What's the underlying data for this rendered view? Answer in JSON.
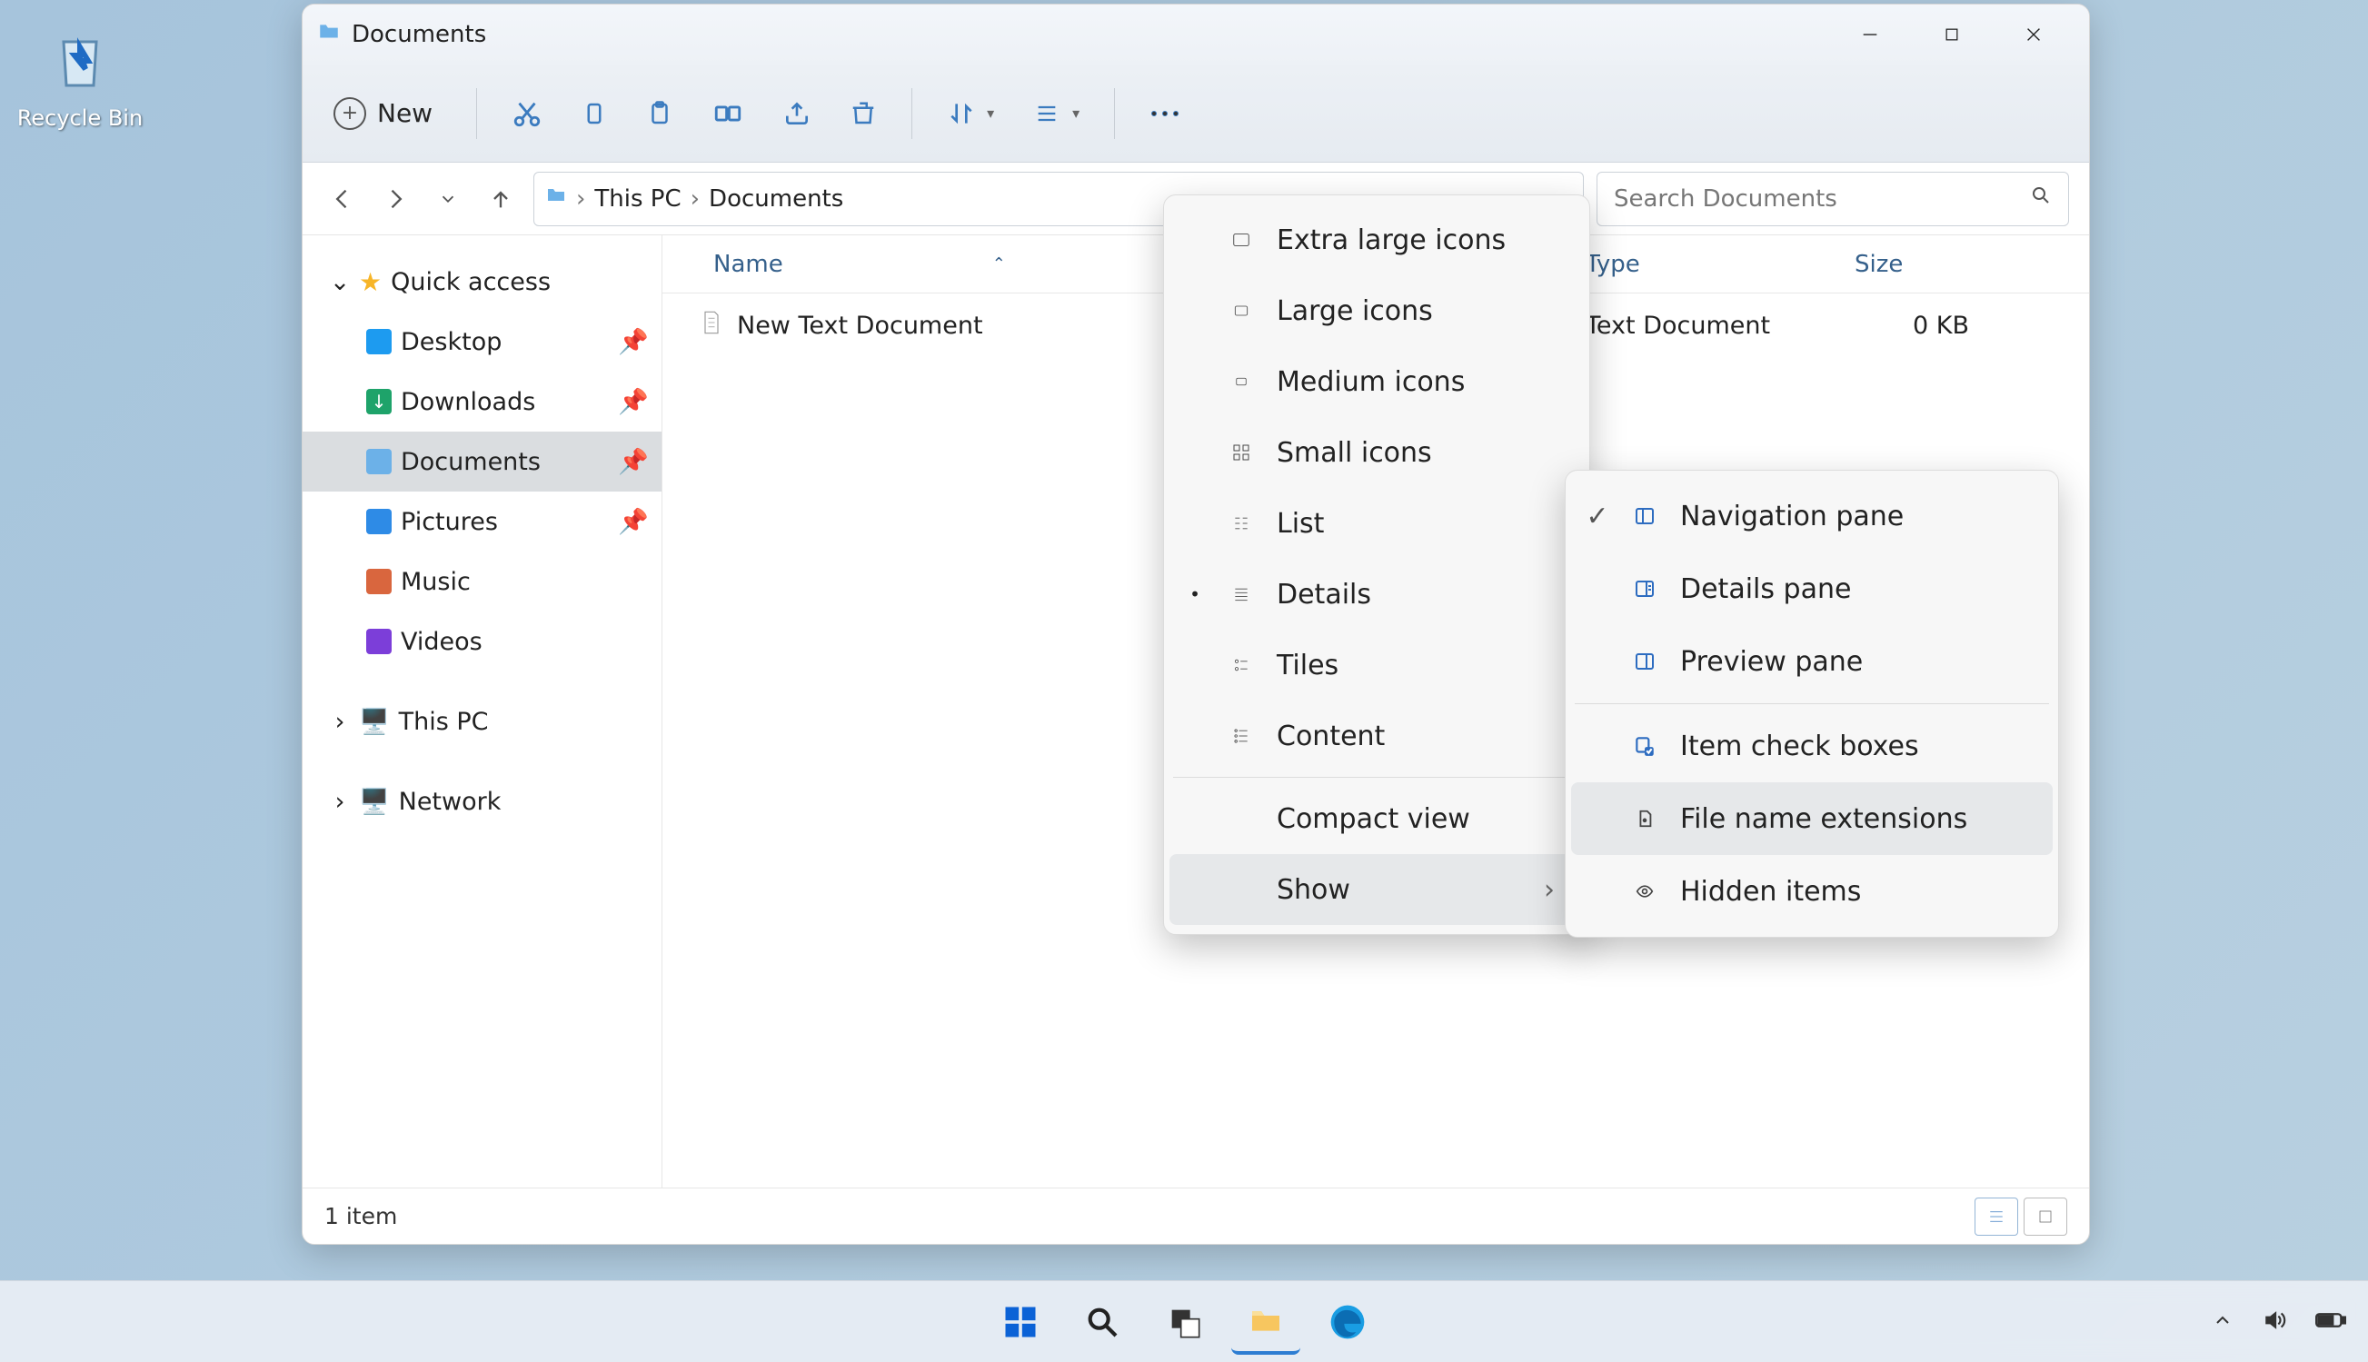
{
  "desktop": {
    "recycle_bin": "Recycle Bin"
  },
  "window": {
    "title": "Documents",
    "toolbar": {
      "new": "New",
      "cut": "Cut",
      "copy": "Copy",
      "paste": "Paste",
      "rename": "Rename",
      "share": "Share",
      "delete": "Delete",
      "sort": "Sort",
      "layout": "Layout",
      "more": "More"
    },
    "address": {
      "root": "This PC",
      "current": "Documents"
    },
    "search_placeholder": "Search Documents",
    "columns": {
      "name": "Name",
      "type": "Type",
      "size": "Size"
    },
    "sidebar": {
      "quick_access": "Quick access",
      "desktop": "Desktop",
      "downloads": "Downloads",
      "documents": "Documents",
      "pictures": "Pictures",
      "music": "Music",
      "videos": "Videos",
      "this_pc": "This PC",
      "network": "Network"
    },
    "file": {
      "name": "New Text Document",
      "type": "Text Document",
      "size": "0 KB"
    },
    "status": "1 item"
  },
  "view_menu": {
    "extra_large": "Extra large icons",
    "large": "Large icons",
    "medium": "Medium icons",
    "small": "Small icons",
    "list": "List",
    "details": "Details",
    "tiles": "Tiles",
    "content": "Content",
    "compact": "Compact view",
    "show": "Show"
  },
  "show_menu": {
    "nav_pane": "Navigation pane",
    "details_pane": "Details pane",
    "preview_pane": "Preview pane",
    "item_checkboxes": "Item check boxes",
    "file_ext": "File name extensions",
    "hidden": "Hidden items"
  }
}
